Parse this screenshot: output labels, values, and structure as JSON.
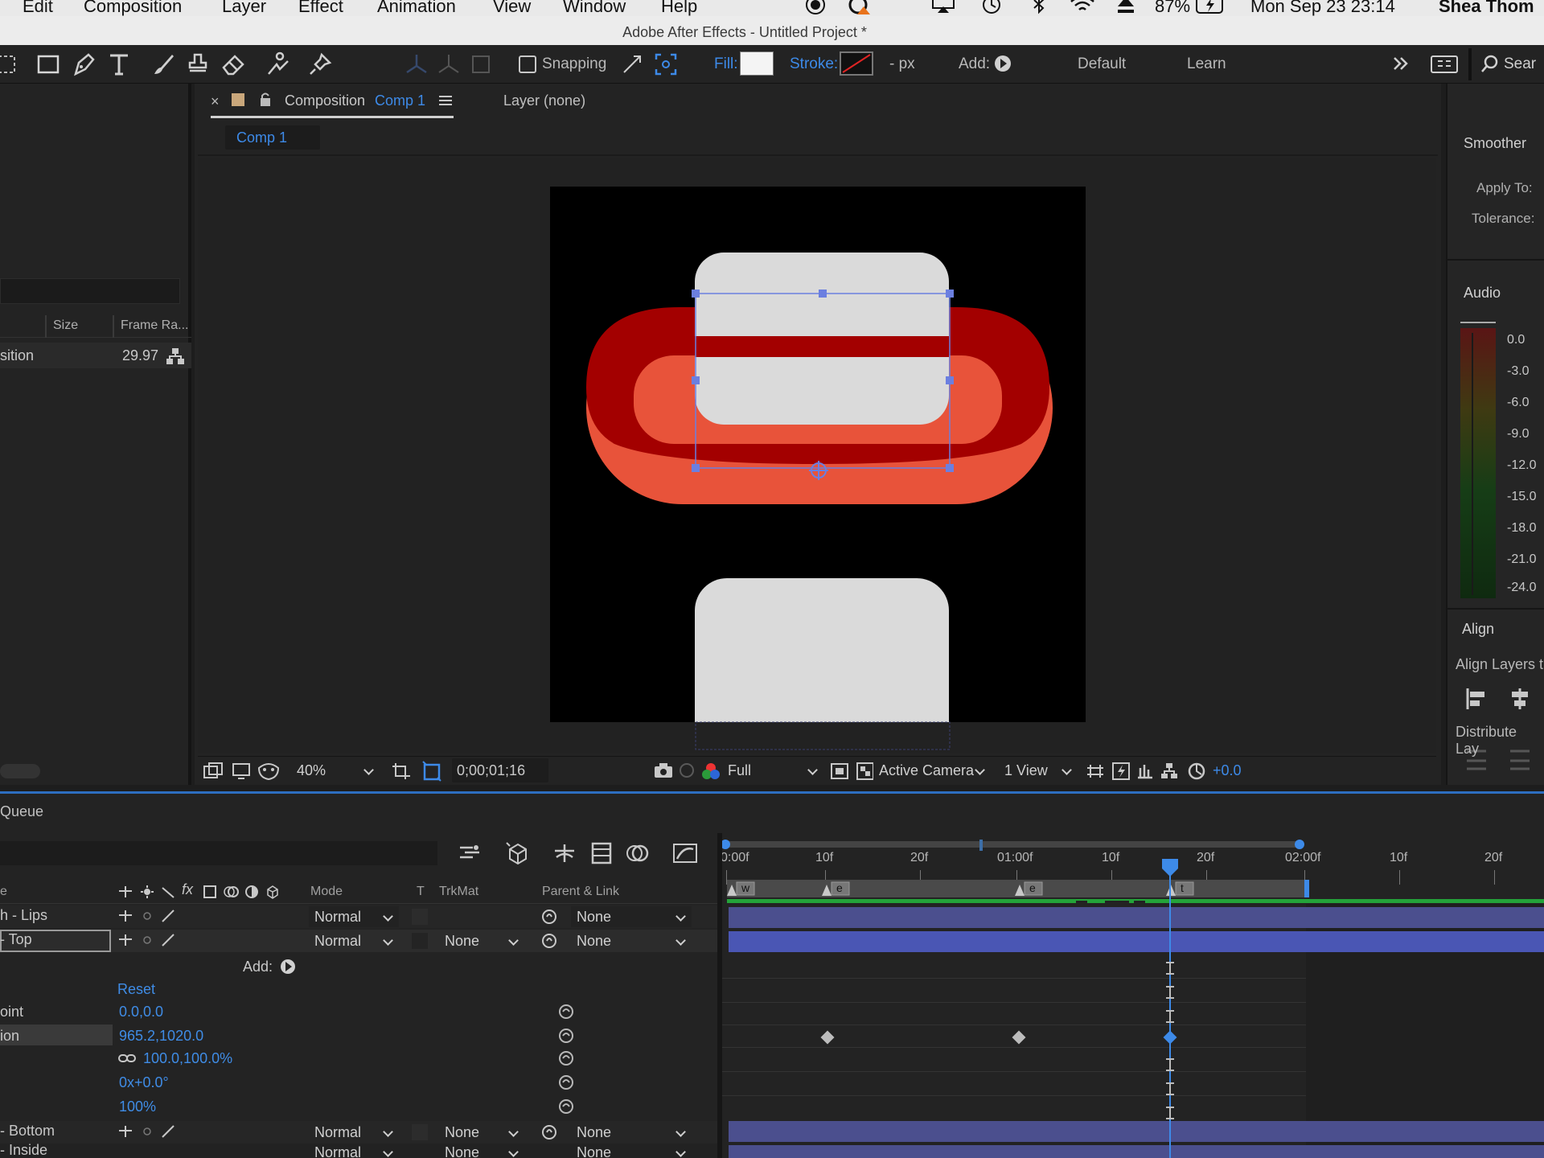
{
  "menubar": {
    "items": [
      "Edit",
      "Composition",
      "Layer",
      "Effect",
      "Animation",
      "View",
      "Window",
      "Help"
    ],
    "battery": "87%",
    "clock": "Mon Sep 23  23:14",
    "user": "Shea Thom"
  },
  "window": {
    "title": "Adobe After Effects - Untitled Project *"
  },
  "toolbar": {
    "snapping_label": "Snapping",
    "fill_label": "Fill:",
    "stroke_label": "Stroke:",
    "stroke_width": "- px",
    "add_label": "Add:",
    "workspace_default": "Default",
    "workspace_learn": "Learn",
    "search_placeholder": "Sear"
  },
  "project_panel": {
    "col_size": "Size",
    "col_framerate": "Frame Ra...",
    "item_name": "sition",
    "item_framerate": "29.97"
  },
  "comp_panel": {
    "tab_prefix": "Composition",
    "tab_comp": "Comp 1",
    "layer_tab": "Layer (none)",
    "comp_chip": "Comp 1"
  },
  "viewer": {
    "zoom": "40%",
    "timecode": "0;00;01;16",
    "resolution": "Full",
    "camera": "Active Camera",
    "views": "1 View",
    "exposure": "+0.0"
  },
  "right_panel": {
    "smoother_title": "Smoother",
    "apply_to": "Apply To:",
    "tolerance": "Tolerance:",
    "audio_title": "Audio",
    "meter_labels": [
      "0.0",
      "-3.0",
      "-6.0",
      "-9.0",
      "-12.0",
      "-15.0",
      "-18.0",
      "-21.0",
      "-24.0"
    ],
    "align_title": "Align",
    "align_layers": "Align Layers t",
    "distribute": "Distribute Lay"
  },
  "timeline": {
    "tab_label": "Queue",
    "col_name": "e",
    "col_mode": "Mode",
    "col_t": "T",
    "col_trkmat": "TrkMat",
    "col_parent": "Parent & Link",
    "ruler_labels": [
      "0:00f",
      "10f",
      "20f",
      "01:00f",
      "10f",
      "20f",
      "02:00f",
      "10f",
      "20f"
    ],
    "markers": [
      "w",
      "e",
      "e",
      "t"
    ],
    "layers": [
      {
        "name": "h - Lips",
        "mode": "Normal",
        "trkmat": "",
        "parent": "None"
      },
      {
        "name": "- Top",
        "mode": "Normal",
        "trkmat": "None",
        "parent": "None"
      },
      {
        "name": "- Bottom",
        "mode": "Normal",
        "trkmat": "None",
        "parent": "None"
      },
      {
        "name": "- Inside",
        "mode": "Normal",
        "trkmat": "None",
        "parent": "None"
      }
    ],
    "add_label": "Add:",
    "reset_label": "Reset",
    "properties": [
      {
        "name": "oint",
        "value": "0.0,0.0"
      },
      {
        "name": "ion",
        "value": "965.2,1020.0"
      },
      {
        "name": "",
        "value": "100.0,100.0%"
      },
      {
        "name": "",
        "value": "0x+0.0°"
      },
      {
        "name": "",
        "value": "100%"
      }
    ]
  },
  "colors": {
    "accent_blue": "#3d8ae8",
    "lips_outer": "#a30000",
    "lips_inner": "#e8533a",
    "teeth": "#dadada",
    "layer_bar": "#4a4f8f"
  }
}
